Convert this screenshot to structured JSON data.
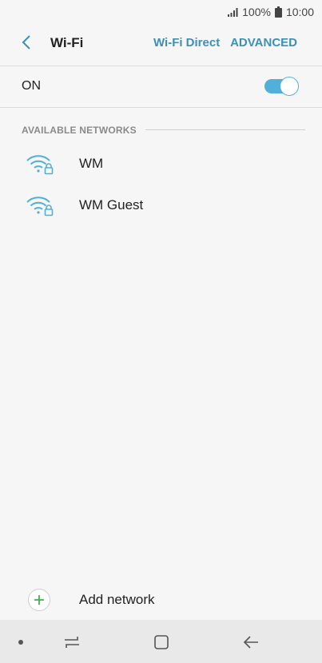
{
  "status": {
    "battery": "100%",
    "time": "10:00",
    "icons": [
      "signal-icon",
      "battery-icon"
    ]
  },
  "header": {
    "title": "Wi-Fi",
    "wifi_direct_label": "Wi-Fi Direct",
    "advanced_label": "ADVANCED"
  },
  "master_switch": {
    "label": "ON",
    "enabled": true
  },
  "available_networks": {
    "section_title": "AVAILABLE NETWORKS",
    "items": [
      {
        "name": "WM",
        "icon": "wifi-locked-icon"
      },
      {
        "name": "WM Guest",
        "icon": "wifi-locked-icon"
      }
    ]
  },
  "add_network": {
    "label": "Add network",
    "icon": "plus-icon"
  },
  "nav_bar": {
    "buttons": [
      "dot-indicator-icon",
      "recent-apps-icon",
      "home-icon",
      "back-icon"
    ]
  },
  "colors": {
    "accent": "#3d8fb4",
    "toggle_on": "#50b0d9",
    "plus_green": "#3fb34f",
    "background": "#f6f6f6",
    "nav_bar": "#e9e9e9"
  }
}
